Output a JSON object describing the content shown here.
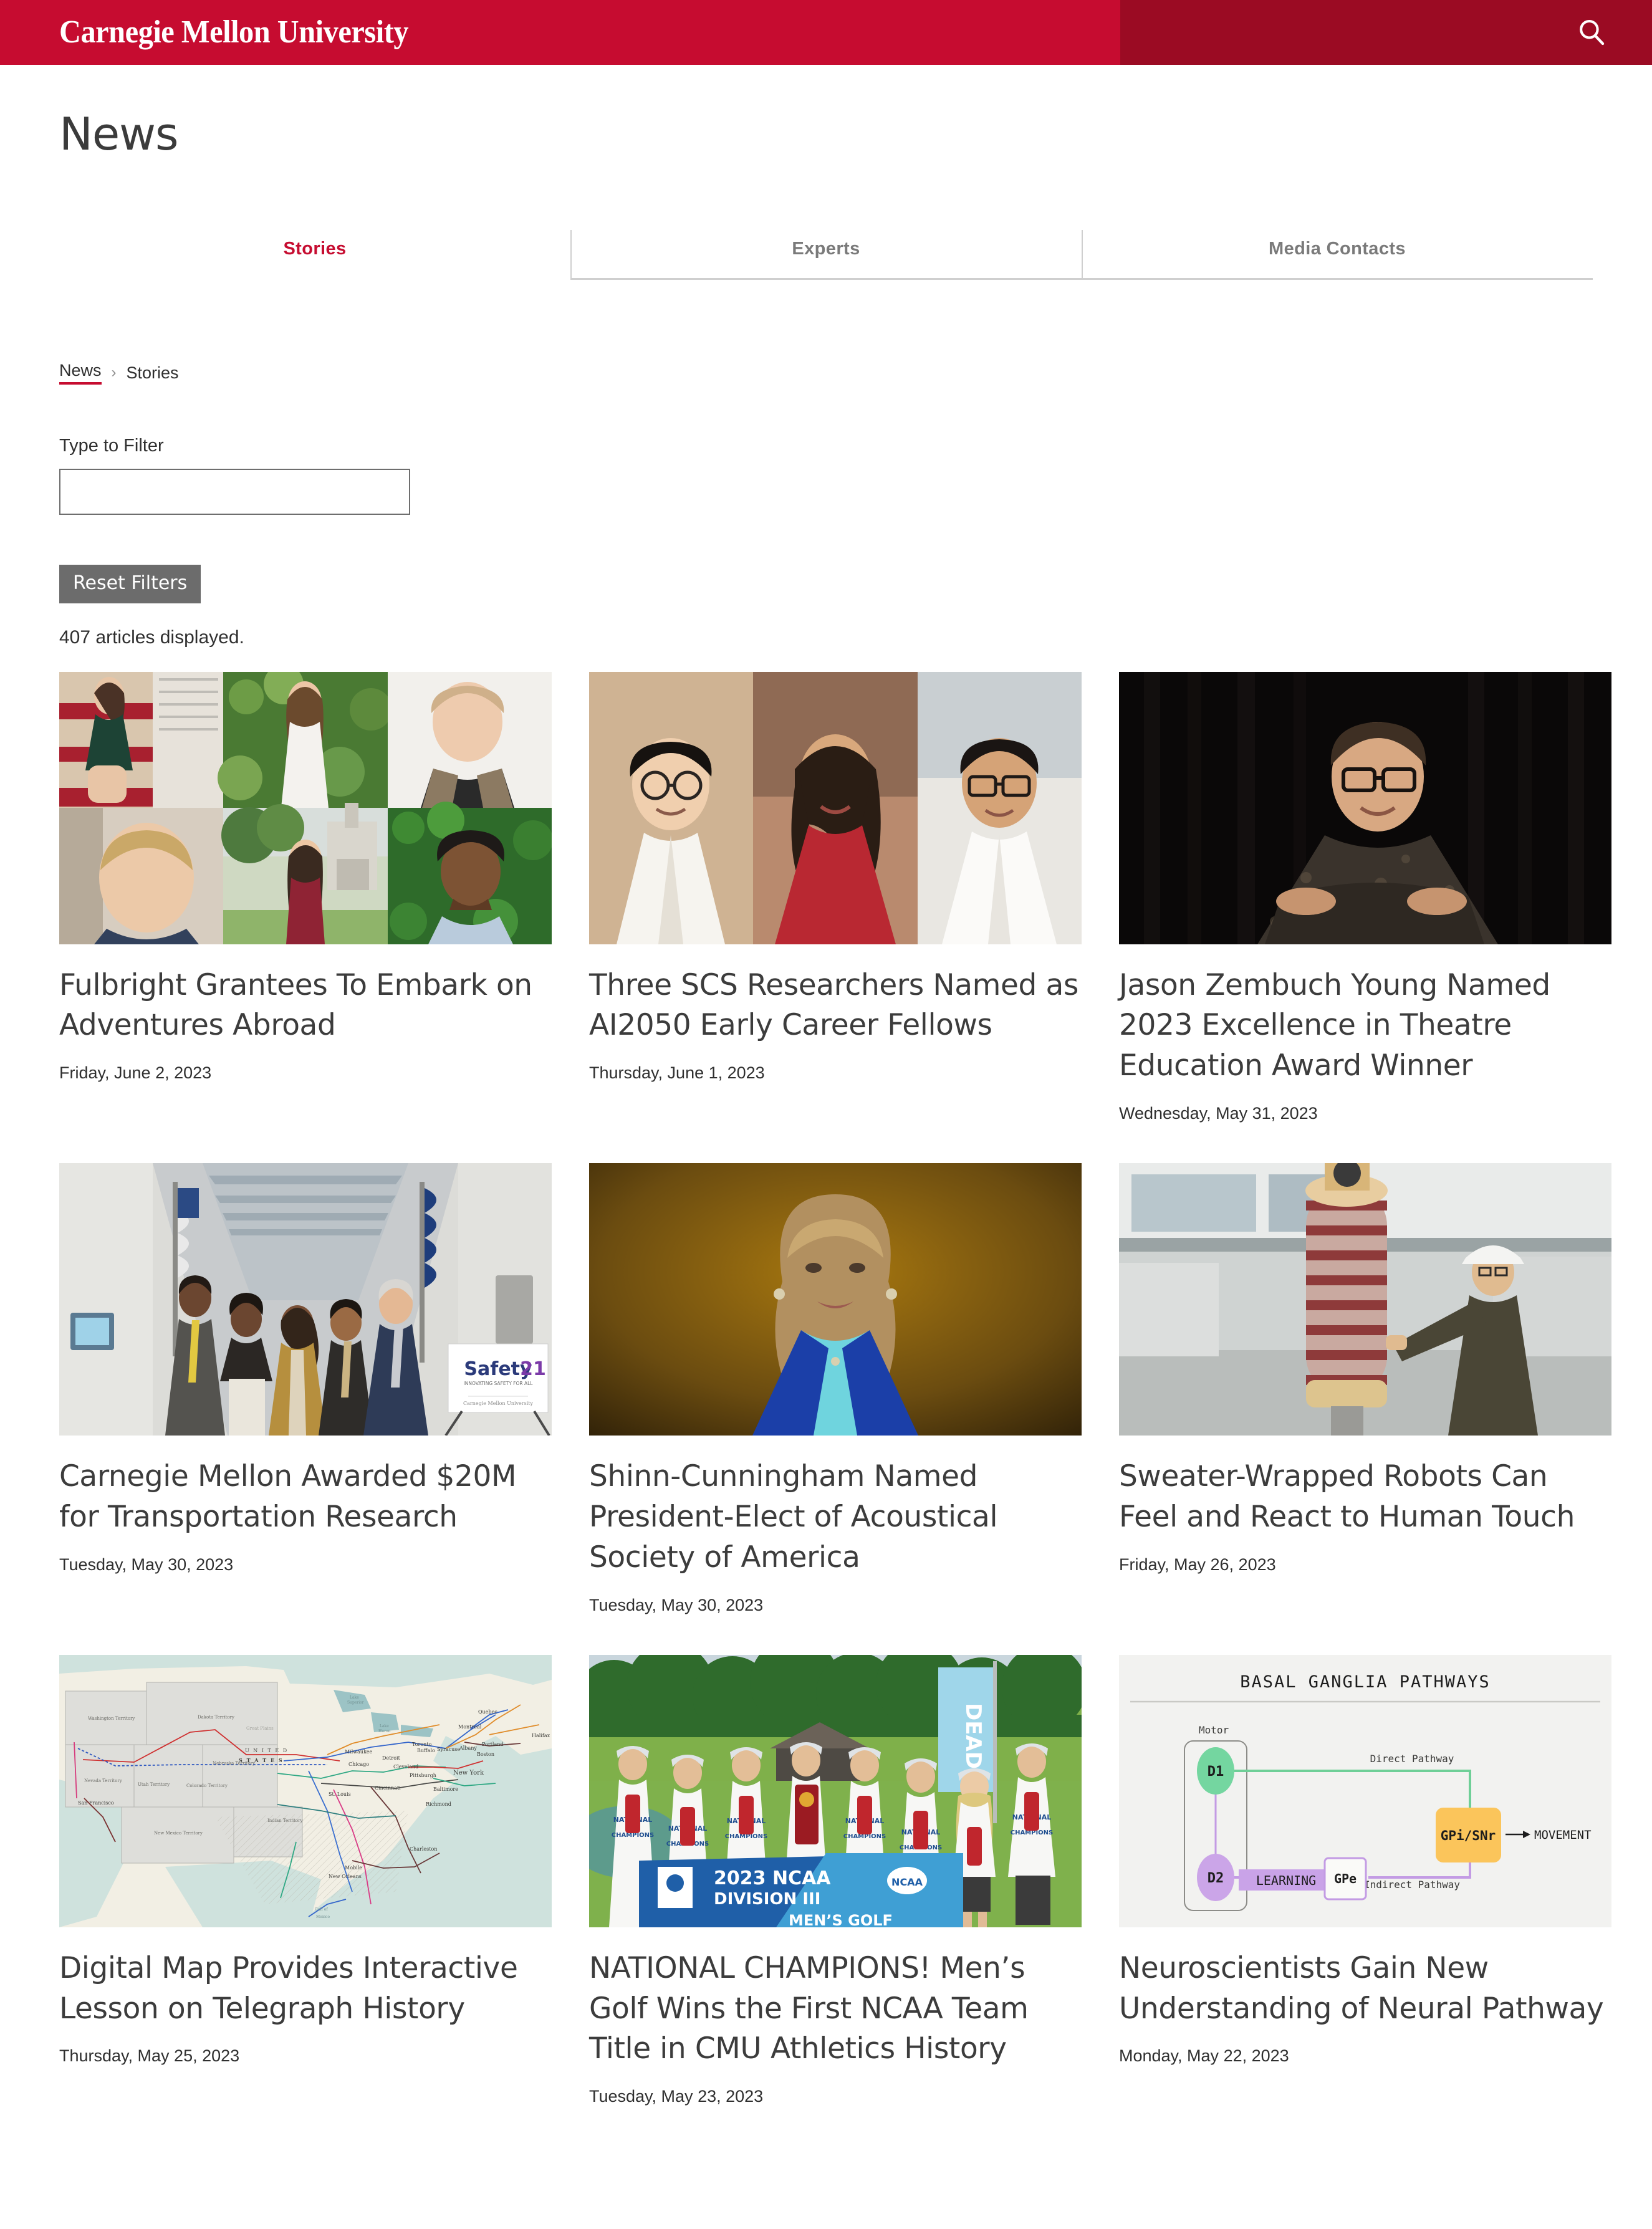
{
  "site": {
    "wordmark": "Carnegie Mellon University",
    "search_icon": "search-icon",
    "brand_red": "#C60C30",
    "brand_red_dark": "#9B0B23"
  },
  "page": {
    "title": "News"
  },
  "tabs": [
    {
      "label": "Stories",
      "active": true
    },
    {
      "label": "Experts",
      "active": false
    },
    {
      "label": "Media Contacts",
      "active": false
    }
  ],
  "breadcrumb": {
    "root": "News",
    "separator": "›",
    "current": "Stories"
  },
  "filters": {
    "label": "Type to Filter",
    "value": "",
    "placeholder": "",
    "reset_label": "Reset Filters",
    "count_text": "407 articles displayed."
  },
  "articles": [
    {
      "title": "Fulbright Grantees To Embark on Adventures Abroad",
      "date": "Friday, June 2, 2023",
      "image": "portrait-grid-six-students"
    },
    {
      "title": "Three SCS Researchers Named as AI2050 Early Career Fellows",
      "date": "Thursday, June 1, 2023",
      "image": "three-researcher-headshots"
    },
    {
      "title": "Jason Zembuch Young Named 2023 Excellence in Theatre Education Award Winner",
      "date": "Wednesday, May 31, 2023",
      "image": "man-dark-background-portrait"
    },
    {
      "title": "Carnegie Mellon Awarded $20M for Transportation Research",
      "date": "Tuesday, May 30, 2023",
      "image": "safety21-group-photo"
    },
    {
      "title": "Shinn-Cunningham Named President-Elect of Acoustical Society of America",
      "date": "Tuesday, May 30, 2023",
      "image": "woman-blue-jacket-portrait"
    },
    {
      "title": "Sweater-Wrapped Robots Can Feel and React to Human Touch",
      "date": "Friday, May 26, 2023",
      "image": "robot-arm-sweater-lab"
    },
    {
      "title": "Digital Map Provides Interactive Lesson on Telegraph History",
      "date": "Thursday, May 25, 2023",
      "image": "historic-us-telegraph-map"
    },
    {
      "title": "NATIONAL CHAMPIONS! Men’s Golf Wins the First NCAA Team Title in CMU Athletics History",
      "date": "Tuesday, May 23, 2023",
      "image": "ncaa-golf-champions-team"
    },
    {
      "title": "Neuroscientists Gain New Understanding of Neural Pathway",
      "date": "Monday, May 22, 2023",
      "image": "basal-ganglia-diagram"
    }
  ],
  "diagram": {
    "title": "BASAL GANGLIA PATHWAYS",
    "region_label": "Motor",
    "nodes": {
      "d1": "D1",
      "d2": "D2",
      "gpe": "GPe",
      "gpi": "GPi/SNr"
    },
    "labels": {
      "direct": "Direct Pathway",
      "indirect": "Indirect Pathway",
      "learning": "LEARNING",
      "movement": "MOVEMENT",
      "arrow": "→"
    },
    "colors": {
      "d1": "#74D6A0",
      "d2": "#CBA5E8",
      "gpi": "#FBC55B",
      "direct_line": "#6FCF97",
      "indirect_line": "#C39BE4",
      "panel_bg": "#F2F2F0"
    }
  },
  "map_image": {
    "labels": [
      "Washington Territory",
      "Dakota Territory",
      "Nebraska Territory",
      "Nevada Territory",
      "Utah Territory",
      "Colorado Territory",
      "New Mexico Territory",
      "Indian Territory",
      "UNITED",
      "STATES",
      "Great Plains",
      "San Francisco",
      "St. Louis",
      "Chicago",
      "Detroit",
      "Cleveland",
      "Cincinnati",
      "Pittsburgh",
      "New York",
      "Baltimore",
      "Richmond",
      "Charleston",
      "Mobile",
      "New Orleans",
      "Boston",
      "Albany",
      "Syracuse",
      "Buffalo",
      "Toronto",
      "Montreal",
      "Quebec",
      "Portland",
      "Halifax",
      "Milwaukee",
      "Lake Superior",
      "Lake Huron"
    ]
  },
  "golf_image": {
    "banner_line1": "2023 NCAA",
    "banner_line2": "DIVISION III",
    "banner_line3": "MEN’S GOLF",
    "shirt_text": "NATIONAL CHAMPIONS",
    "flag_text": "DEAD"
  },
  "safety21_image": {
    "sign_text": "Safety21",
    "sign_tagline": "INNOVATING SAFETY FOR ALL",
    "sign_footer": "Carnegie Mellon University"
  }
}
